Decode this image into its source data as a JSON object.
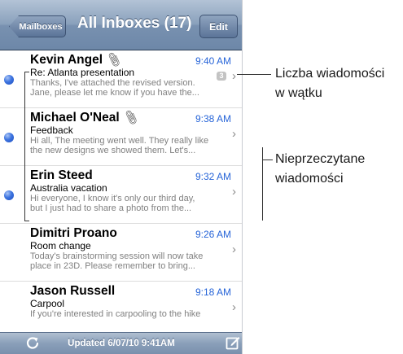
{
  "navbar": {
    "back_label": "Mailboxes",
    "title": "All Inboxes (17)",
    "edit_label": "Edit"
  },
  "messages": [
    {
      "sender": "Kevin Angel",
      "has_attachment": true,
      "time": "9:40 AM",
      "subject": "Re: Atlanta presentation",
      "preview": "Thanks, I've attached the revised version.\nJane, please let me know if you have the...",
      "unread": true,
      "thread_count": "3"
    },
    {
      "sender": "Michael O'Neal",
      "has_attachment": true,
      "time": "9:38 AM",
      "subject": "Feedback",
      "preview": "Hi all, The meeting went well. They really like\nthe new designs we showed them. Let's...",
      "unread": true
    },
    {
      "sender": "Erin Steed",
      "has_attachment": false,
      "time": "9:32 AM",
      "subject": "Australia vacation",
      "preview": "Hi everyone, I know it's only our third day,\nbut I just had to share a photo from the...",
      "unread": true
    },
    {
      "sender": "Dimitri Proano",
      "has_attachment": false,
      "time": "9:26 AM",
      "subject": "Room change",
      "preview": "Today's brainstorming session will now take\nplace in 23D. Please remember to bring...",
      "unread": false
    },
    {
      "sender": "Jason Russell",
      "has_attachment": false,
      "time": "9:18 AM",
      "subject": "Carpool",
      "preview": "If you're interested in carpooling to the hike",
      "unread": false
    }
  ],
  "toolbar": {
    "updated_text": "Updated 6/07/10 9:41AM",
    "refresh_icon": "refresh-icon",
    "compose_icon": "compose-icon"
  },
  "annotations": {
    "thread_count_line1": "Liczba wiadomości",
    "thread_count_line2": "w wątku",
    "unread_line1": "Nieprzeczytane",
    "unread_line2": "wiadomości"
  },
  "colors": {
    "accent_time": "#2664d8",
    "unread_dot": "#3d74e0",
    "navbar": "#7891b0"
  }
}
